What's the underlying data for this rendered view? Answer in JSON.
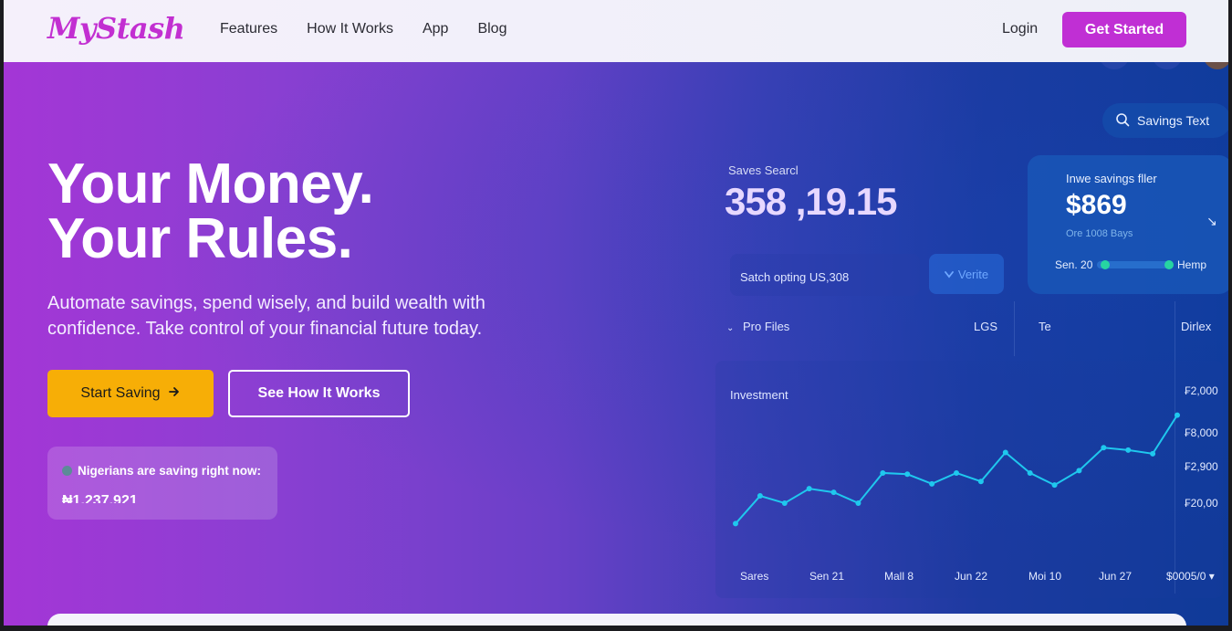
{
  "nav": {
    "logo": "MyStash",
    "links": [
      "Features",
      "How It Works",
      "App",
      "Blog"
    ],
    "login": "Login",
    "cta": "Get Started"
  },
  "hero": {
    "headline_line1": "Your Money.",
    "headline_line2": "Your Rules.",
    "subtext": "Automate savings, spend wisely, and build wealth with confidence. Take control of your financial future today.",
    "primary_button": "Start Saving",
    "secondary_button": "See How It Works",
    "counter_label": "Nigerians are saving right now:",
    "counter_value": "₦1,237,921"
  },
  "dashboard": {
    "search_label": "Savings Text",
    "saves_label": "Saves Searcl",
    "saves_value": "358 ,19.15",
    "savings_card": {
      "label": "Inwe savings fller",
      "value": "$869",
      "sub": "Ore 1008 Bays",
      "start": "Sen. 20",
      "end": "Hemp"
    },
    "option_text": "Satch opting US,308",
    "verify_button": "Verite",
    "tabs": [
      "Pro Files",
      "LGS",
      "Te",
      "Dirlex"
    ],
    "chart_title": "Investment"
  },
  "chart_data": {
    "type": "line",
    "title": "Investment",
    "x_ticks": [
      "Sares",
      "Sen 21",
      "Mall 8",
      "Jun 22",
      "Moi 10",
      "Jun 27",
      "$0005/0"
    ],
    "y_ticks": [
      "₣2,000",
      "₣8,000",
      "₣2,900",
      "₣20,00"
    ],
    "ylim": [
      0,
      100
    ],
    "series": [
      {
        "color": "#1fc8ee",
        "values": [
          5,
          28,
          22,
          34,
          31,
          22,
          47,
          46,
          38,
          47,
          40,
          64,
          47,
          37,
          49,
          68,
          66,
          63,
          95
        ]
      }
    ]
  },
  "colors": {
    "brand": "#c02fd4",
    "accent_yellow": "#f7ae06",
    "chart_line": "#1fc8ee"
  }
}
